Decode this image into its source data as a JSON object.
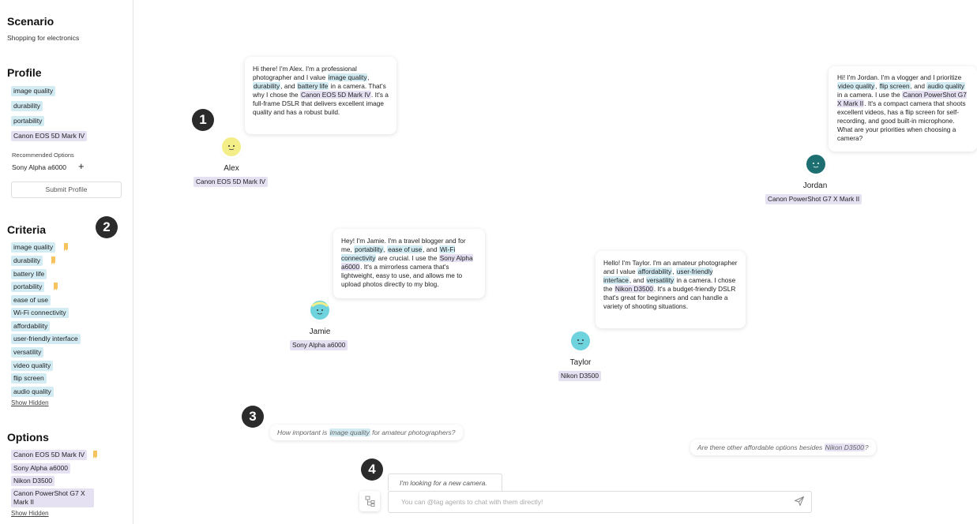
{
  "sidebar": {
    "scenario_title": "Scenario",
    "scenario_text": "Shopping for electronics",
    "profile_title": "Profile",
    "profile_items": [
      "image quality",
      "durability",
      "portability",
      "Canon EOS 5D Mark IV"
    ],
    "recommended_label": "Recommended Options",
    "recommended_item": "Sony Alpha a6000",
    "add_symbol": "+",
    "submit_label": "Submit Profile",
    "criteria_title": "Criteria",
    "criteria_items": [
      "image quality",
      "durability",
      "battery life",
      "portability",
      "ease of use",
      "Wi-Fi connectivity",
      "affordability",
      "user-friendly interface",
      "versatility",
      "video quality",
      "flip screen",
      "audio quality"
    ],
    "criteria_show_hidden": "Show Hidden",
    "options_title": "Options",
    "options_items": [
      "Canon EOS 5D Mark IV",
      "Sony Alpha a6000",
      "Nikon D3500",
      "Canon PowerShot G7 X Mark II"
    ],
    "options_show_hidden": "Show Hidden"
  },
  "markers": [
    "1",
    "2",
    "3",
    "4"
  ],
  "agents": [
    {
      "name": "Alex",
      "product": "Canon EOS 5D Mark IV",
      "avatar_color": "#f3ee88",
      "message": [
        [
          "t",
          "Hi there! I'm Alex. I'm a professional photographer and I value "
        ],
        [
          "b",
          "image quality"
        ],
        [
          "t",
          ", "
        ],
        [
          "b",
          "durability"
        ],
        [
          "t",
          ", and "
        ],
        [
          "b",
          "battery life"
        ],
        [
          "t",
          " in a camera. That's why I chose the "
        ],
        [
          "p",
          "Canon EOS 5D Mark IV"
        ],
        [
          "t",
          ". It's a full-frame DSLR that delivers excellent image quality and has a robust build."
        ]
      ]
    },
    {
      "name": "Jordan",
      "product": "Canon PowerShot G7 X Mark II",
      "avatar_color": "#1e6f72",
      "message": [
        [
          "t",
          "Hi! I'm Jordan. I'm a vlogger and I prioritize "
        ],
        [
          "b",
          "video quality"
        ],
        [
          "t",
          ", "
        ],
        [
          "b",
          "flip screen"
        ],
        [
          "t",
          ", and "
        ],
        [
          "b",
          "audio quality"
        ],
        [
          "t",
          " in a camera. I use the "
        ],
        [
          "p",
          "Canon PowerShot G7 X Mark II"
        ],
        [
          "t",
          ". It's a compact camera that shoots excellent videos, has a flip screen for self-recording, and good built-in microphone. What are your priorities when choosing a camera?"
        ]
      ]
    },
    {
      "name": "Jamie",
      "product": "Sony Alpha a6000",
      "avatar_color": "#6fd3dd",
      "message": [
        [
          "t",
          "Hey! I'm Jamie. I'm a travel blogger and for me, "
        ],
        [
          "b",
          "portability"
        ],
        [
          "t",
          ", "
        ],
        [
          "b",
          "ease of use"
        ],
        [
          "t",
          ", and "
        ],
        [
          "b",
          "Wi-Fi connectivity"
        ],
        [
          "t",
          " are crucial. I use the "
        ],
        [
          "p",
          "Sony Alpha a6000"
        ],
        [
          "t",
          ". It's a mirrorless camera that's lightweight, easy to use, and allows me to upload photos directly to my blog."
        ]
      ]
    },
    {
      "name": "Taylor",
      "product": "Nikon D3500",
      "avatar_color": "#6fd3dd",
      "message": [
        [
          "t",
          "Hello! I'm Taylor. I'm an amateur photographer and I value "
        ],
        [
          "b",
          "affordability"
        ],
        [
          "t",
          ", "
        ],
        [
          "b",
          "user-friendly interface"
        ],
        [
          "t",
          ", and "
        ],
        [
          "b",
          "versatility"
        ],
        [
          "t",
          " in a camera. I chose the "
        ],
        [
          "p",
          "Nikon D3500"
        ],
        [
          "t",
          ". It's a budget-friendly DSLR that's great for beginners and can handle a variety of shooting situations."
        ]
      ]
    }
  ],
  "suggestions": [
    [
      [
        "t",
        "How important is "
      ],
      [
        "b",
        "image quality"
      ],
      [
        "t",
        " for amateur photographers?"
      ]
    ],
    [
      [
        "t",
        "Are there other affordable options besides "
      ],
      [
        "p",
        "Nikon D3500"
      ],
      [
        "t",
        "?"
      ]
    ]
  ],
  "chat": {
    "draft_tab": "I'm looking for a new camera.",
    "input_placeholder": "You can @tag agents to chat with them directly!"
  },
  "colors": {
    "highlight_criteria": "#d3ecf4",
    "highlight_option": "#e6e0f3",
    "bookmark": "#f6c35f"
  }
}
